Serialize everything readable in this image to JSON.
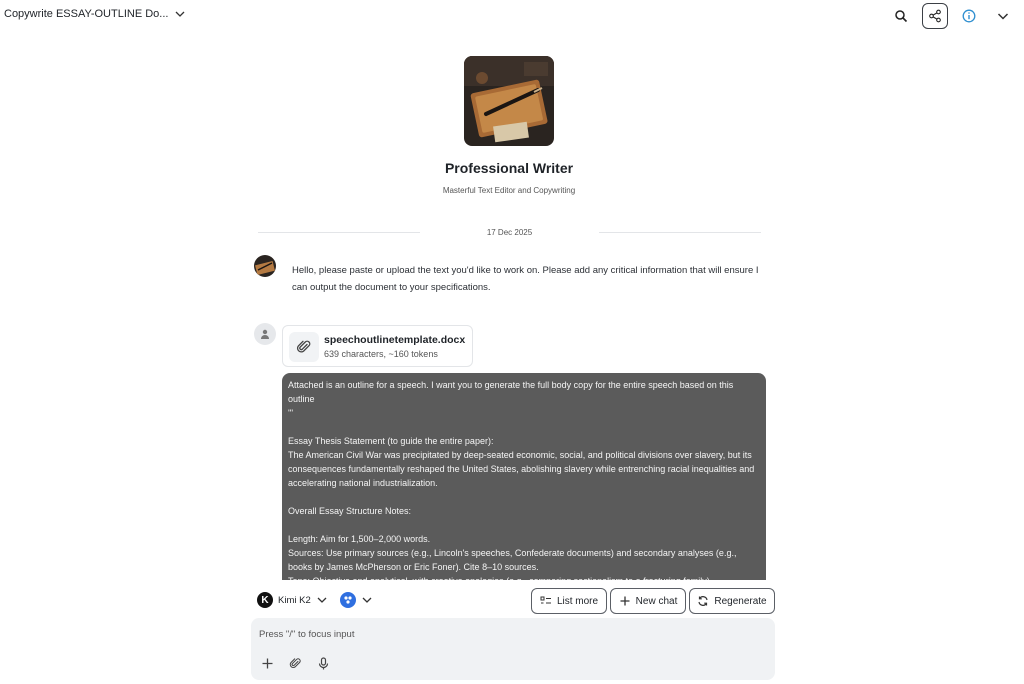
{
  "header": {
    "title": "Copywrite ESSAY-OUTLINE Do...",
    "icons": [
      "chevron-down-icon",
      "search-icon",
      "share-icon",
      "info-icon",
      "chevron-down-icon"
    ]
  },
  "assistant": {
    "name": "Professional Writer",
    "description": "Masterful Text Editor and Copywriting"
  },
  "conversation": {
    "date": "17 Dec 2025",
    "bot_message": "Hello, please paste or upload the text you'd like to work on. Please add any critical information that will ensure I can output the document to your specifications.",
    "attachment": {
      "file_name": "speechoutlinetemplate.docx",
      "meta": "639 characters, ~160 tokens"
    },
    "user_message": "Attached is an outline for a speech. I want you to generate the full body copy for the entire speech based on this outline\n'''\n\nEssay Thesis Statement (to guide the entire paper):\nThe American Civil War was precipitated by deep-seated economic, social, and political divisions over slavery, but its consequences fundamentally reshaped the United States, abolishing slavery while entrenching racial inequalities and accelerating national industrialization.\n\nOverall Essay Structure Notes:\n\nLength: Aim for 1,500–2,000 words.\nSources: Use primary sources (e.g., Lincoln's speeches, Confederate documents) and secondary analyses (e.g., books by James McPherson or Eric Foner). Cite 8–10 sources.\nTone: Objective and analytical, with creative analogies (e.g., comparing sectionalism to a fracturing family)."
  },
  "toolbar": {
    "model_name": "Kimi K2",
    "model_logo_letter": "K",
    "list_more_label": "List more",
    "new_chat_label": "New chat",
    "regenerate_label": "Regenerate"
  },
  "input": {
    "placeholder": "Press \"/\" to focus input",
    "icons": [
      "plus-icon",
      "paperclip-icon",
      "microphone-icon"
    ]
  },
  "colors": {
    "user_bubble": "#5b5b5b",
    "input_bg": "#f0f2f4",
    "tool_accent": "#2f6fe0"
  }
}
